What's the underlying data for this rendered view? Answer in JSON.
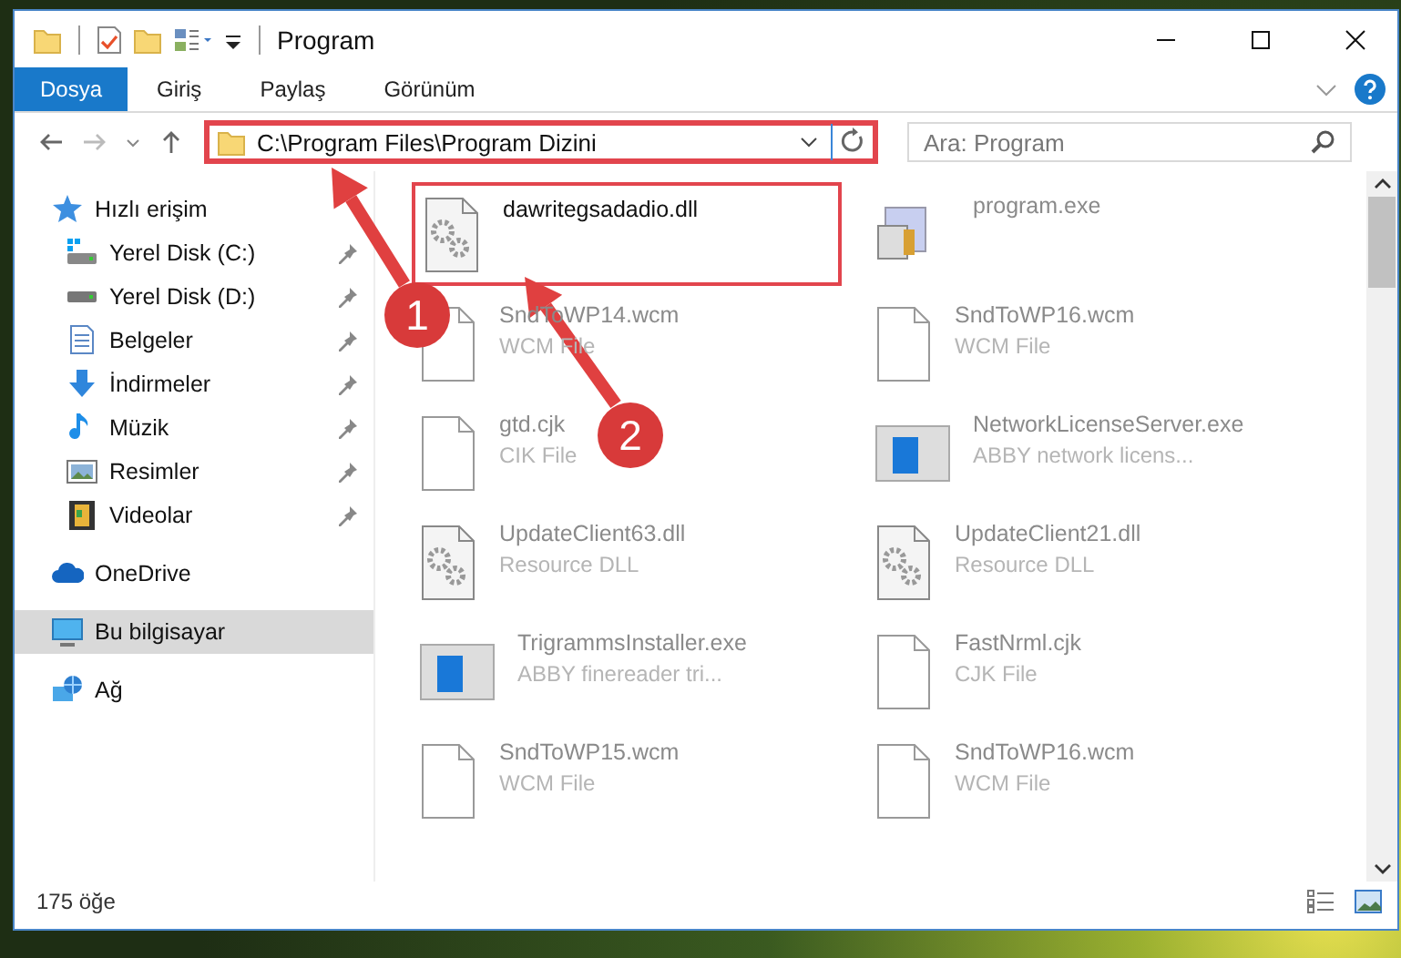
{
  "window": {
    "title": "Program"
  },
  "ribbon": {
    "tabs": [
      {
        "label": "Dosya",
        "selected": true
      },
      {
        "label": "Giriş",
        "selected": false
      },
      {
        "label": "Paylaş",
        "selected": false
      },
      {
        "label": "Görünüm",
        "selected": false
      }
    ]
  },
  "address": {
    "path": "C:\\Program Files\\Program Dizini",
    "highlighted": true
  },
  "search": {
    "placeholder": "Ara: Program"
  },
  "sidebar": {
    "items": [
      {
        "label": "Hızlı erişim",
        "kind": "star",
        "selected": false,
        "children": [
          {
            "label": "Yerel Disk (C:)",
            "kind": "windrive",
            "pinned": true,
            "selected": false
          },
          {
            "label": "Yerel Disk (D:)",
            "kind": "drive",
            "pinned": true,
            "selected": false
          },
          {
            "label": "Belgeler",
            "kind": "document",
            "pinned": true,
            "selected": false
          },
          {
            "label": "İndirmeler",
            "kind": "download",
            "pinned": true,
            "selected": false
          },
          {
            "label": "Müzik",
            "kind": "music",
            "pinned": true,
            "selected": false
          },
          {
            "label": "Resimler",
            "kind": "picture",
            "pinned": true,
            "selected": false
          },
          {
            "label": "Videolar",
            "kind": "video",
            "pinned": true,
            "selected": false
          }
        ]
      },
      {
        "label": "OneDrive",
        "kind": "cloud",
        "selected": false
      },
      {
        "label": "Bu bilgisayar",
        "kind": "computer",
        "selected": true
      },
      {
        "label": "Ağ",
        "kind": "network",
        "selected": false
      }
    ]
  },
  "files": [
    {
      "name": "dawritegsadadio.dll",
      "kind": "gears",
      "highlighted": true
    },
    {
      "name": "program.exe",
      "kind": "setup",
      "highlighted": false
    },
    {
      "name": "SndToWP14.wcm",
      "type": "WCM File",
      "kind": "blank",
      "highlighted": false
    },
    {
      "name": "SndToWP16.wcm",
      "type": "WCM File",
      "kind": "blank",
      "highlighted": false
    },
    {
      "name": "gtd.cjk",
      "type": "CIK File",
      "kind": "blank",
      "highlighted": false
    },
    {
      "name": "NetworkLicenseServer.exe",
      "type": "ABBY network licens...",
      "kind": "app",
      "highlighted": false
    },
    {
      "name": "UpdateClient63.dll",
      "type": "Resource DLL",
      "kind": "gears",
      "highlighted": false
    },
    {
      "name": "UpdateClient21.dll",
      "type": "Resource DLL",
      "kind": "gears",
      "highlighted": false
    },
    {
      "name": "TrigrammsInstaller.exe",
      "type": "ABBY finereader tri...",
      "kind": "app",
      "highlighted": false
    },
    {
      "name": "FastNrml.cjk",
      "type": "CJK File",
      "kind": "blank",
      "highlighted": false
    },
    {
      "name": "SndToWP15.wcm",
      "type": "WCM File",
      "kind": "blank",
      "highlighted": false
    },
    {
      "name": "SndToWP16.wcm",
      "type": "WCM File",
      "kind": "blank",
      "highlighted": false
    }
  ],
  "annotations": [
    {
      "number": "1"
    },
    {
      "number": "2"
    }
  ],
  "status_bar": {
    "count": "175 öğe"
  }
}
